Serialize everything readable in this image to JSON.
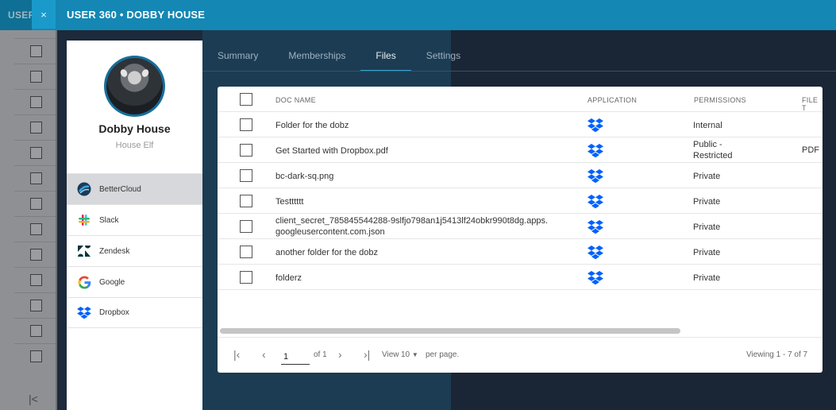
{
  "background_app": {
    "title_fragment": "USER",
    "first_page_icon": "first-page-icon"
  },
  "header": {
    "title": "USER 360 • DOBBY HOUSE",
    "close_label": "×"
  },
  "profile": {
    "name": "Dobby House",
    "role": "House Elf",
    "apps": [
      {
        "label": "BetterCloud",
        "icon": "bettercloud-icon",
        "active": true
      },
      {
        "label": "Slack",
        "icon": "slack-icon",
        "active": false
      },
      {
        "label": "Zendesk",
        "icon": "zendesk-icon",
        "active": false
      },
      {
        "label": "Google",
        "icon": "google-icon",
        "active": false
      },
      {
        "label": "Dropbox",
        "icon": "dropbox-icon",
        "active": false
      }
    ]
  },
  "tabs": [
    {
      "label": "Summary",
      "active": false
    },
    {
      "label": "Memberships",
      "active": false
    },
    {
      "label": "Files",
      "active": true
    },
    {
      "label": "Settings",
      "active": false
    }
  ],
  "table": {
    "columns": [
      "DOC NAME",
      "APPLICATION",
      "PERMISSIONS",
      "FILE T"
    ],
    "rows": [
      {
        "name": "Folder for the dobz",
        "application": "dropbox-icon",
        "permissions": "Internal",
        "file_type": ""
      },
      {
        "name": "Get Started with Dropbox.pdf",
        "application": "dropbox-icon",
        "permissions": "Public - Restricted",
        "file_type": "PDF"
      },
      {
        "name": "bc-dark-sq.png",
        "application": "dropbox-icon",
        "permissions": "Private",
        "file_type": ""
      },
      {
        "name": "Testttttt",
        "application": "dropbox-icon",
        "permissions": "Private",
        "file_type": ""
      },
      {
        "name": "client_secret_785845544288-9slfjo798an1j5413lf24obkr990t8dg.apps.googleusercontent.com.json",
        "application": "dropbox-icon",
        "permissions": "Private",
        "file_type": ""
      },
      {
        "name": "another folder for the dobz",
        "application": "dropbox-icon",
        "permissions": "Private",
        "file_type": ""
      },
      {
        "name": "folderz",
        "application": "dropbox-icon",
        "permissions": "Private",
        "file_type": ""
      }
    ]
  },
  "pagination": {
    "current_page": "1",
    "of_label": "of 1",
    "view_label": "View",
    "page_size": "10",
    "per_page_label": "per page.",
    "viewing_label": "Viewing 1 - 7 of 7"
  },
  "colors": {
    "accent": "#1487b4",
    "active_tab_underline": "#2ea7d6",
    "dropbox": "#0061fe"
  }
}
